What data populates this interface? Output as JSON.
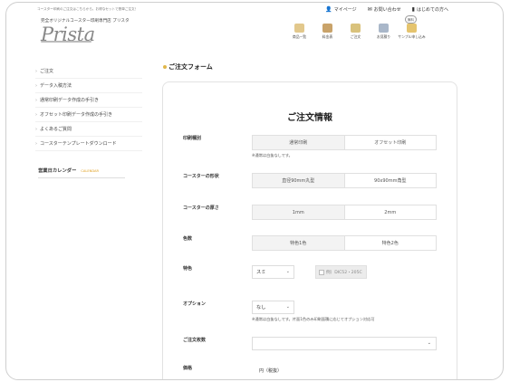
{
  "header": {
    "tagline": "コースター印刷のご注文はこちらから。お得なセットで簡単ご注文！",
    "subtitle": "完全オリジナルコースター印刷専門店 プリスタ",
    "logo_text": "Prista",
    "top_links": [
      {
        "icon": "person-icon",
        "label": "マイページ"
      },
      {
        "icon": "mail-icon",
        "label": "お問い合わせ"
      },
      {
        "icon": "book-icon",
        "label": "はじめての方へ"
      }
    ],
    "nav": [
      {
        "icon": "product-list-icon",
        "label": "商品一覧"
      },
      {
        "icon": "box-icon",
        "label": "料金表"
      },
      {
        "icon": "cart-icon",
        "label": "ご注文"
      },
      {
        "icon": "sample-icon",
        "label": "お見積り"
      },
      {
        "icon": "pen-icon",
        "label": "サンプル申し込み",
        "badge": "無料"
      }
    ]
  },
  "sidebar": {
    "items": [
      {
        "label": "ご注文"
      },
      {
        "label": "データ入稿方法"
      },
      {
        "label": "通常印刷データ作成の手引き"
      },
      {
        "label": "オフセット印刷データ作成の手引き"
      },
      {
        "label": "よくあるご質問"
      },
      {
        "label": "コースターテンプレートダウンロード"
      }
    ],
    "calendar_title": "営業日カレンダー",
    "calendar_sub": "CALENDAR"
  },
  "main": {
    "title": "ご注文フォーム",
    "form_title": "ご注文情報",
    "rows": {
      "print_type": {
        "label": "印刷種別",
        "options": [
          "通常印刷",
          "オフセット印刷"
        ],
        "note": "※通常は白抜なしです。"
      },
      "shape": {
        "label": "コースターの形状",
        "options": [
          "直径90mm丸型",
          "90x90mm角型"
        ]
      },
      "thickness": {
        "label": "コースターの厚さ",
        "options": [
          "1mm",
          "2mm"
        ]
      },
      "colors": {
        "label": "色数",
        "options": [
          "特色1色",
          "特色2色"
        ]
      },
      "spot_color": {
        "label": "特色",
        "value": "スミ",
        "chip_text": "例）DIC52・205C"
      },
      "option": {
        "label": "オプション",
        "value": "なし",
        "note": "※通常は白抜なしです。片面1色のみ印刷面積に応じてオプション対応可"
      },
      "quantity": {
        "label": "ご注文枚数",
        "value": ""
      },
      "price": {
        "label": "価格",
        "value": "円（税抜）"
      }
    }
  }
}
